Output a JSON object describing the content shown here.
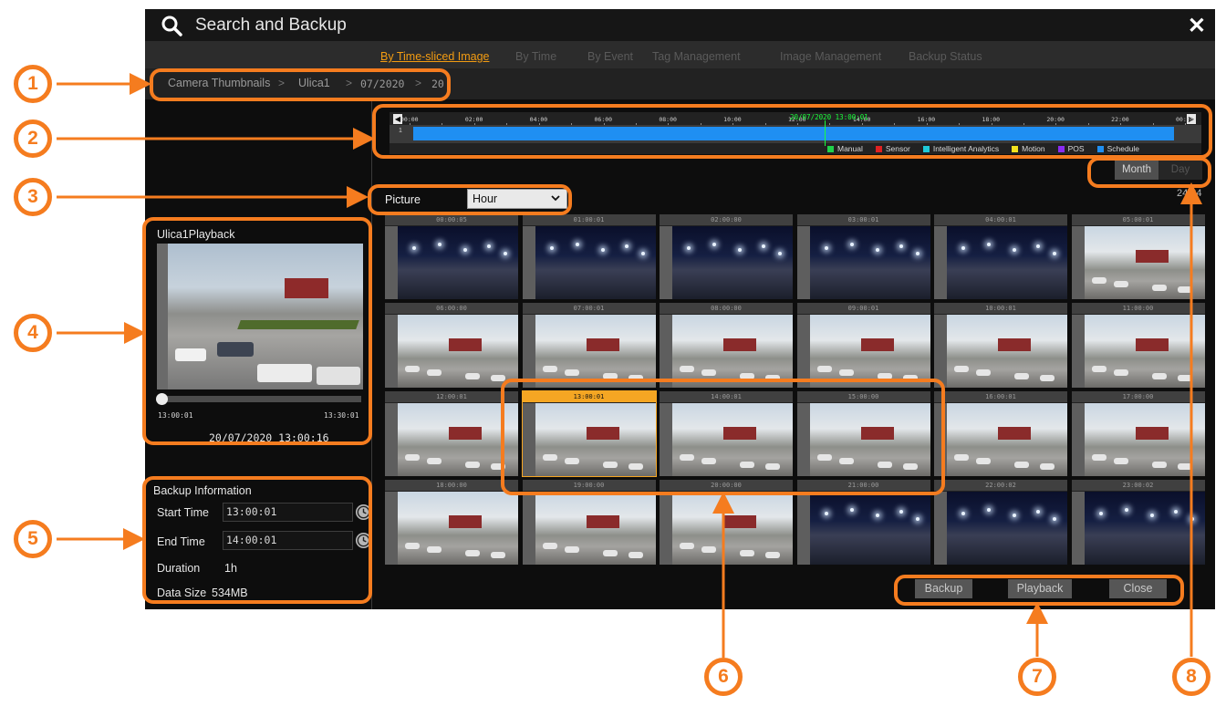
{
  "window": {
    "title": "Search and Backup"
  },
  "tabs": [
    {
      "label": "By Time-sliced Image",
      "active": true
    },
    {
      "label": "By Time"
    },
    {
      "label": "By Event"
    },
    {
      "label": "Tag Management"
    },
    {
      "label": "Image Management"
    },
    {
      "label": "Backup Status"
    }
  ],
  "breadcrumb": [
    "Camera Thumbnails",
    "Ulica1",
    "07/2020",
    "20"
  ],
  "timeline": {
    "channel": "1",
    "current_time": "20/07/2020 13:00:01",
    "hours": [
      "00:00",
      "02:00",
      "04:00",
      "06:00",
      "08:00",
      "10:00",
      "12:00",
      "14:00",
      "16:00",
      "18:00",
      "20:00",
      "22:00",
      "00:00"
    ],
    "legend": [
      {
        "label": "Manual",
        "color": "#1fd14a"
      },
      {
        "label": "Sensor",
        "color": "#e02121"
      },
      {
        "label": "Intelligent Analytics",
        "color": "#1ec9d8"
      },
      {
        "label": "Motion",
        "color": "#f2e21e"
      },
      {
        "label": "POS",
        "color": "#8b2bf2"
      },
      {
        "label": "Schedule",
        "color": "#1f8ff2"
      }
    ],
    "bar_color": "#1f8ff2"
  },
  "view_mode": {
    "month": "Month",
    "day": "Day",
    "selected": "Month"
  },
  "count": "24/24",
  "picture": {
    "label": "Picture",
    "interval": "Hour"
  },
  "thumbnails": [
    {
      "time": "00:00:05",
      "scene": "night"
    },
    {
      "time": "01:00:01",
      "scene": "night"
    },
    {
      "time": "02:00:00",
      "scene": "night"
    },
    {
      "time": "03:00:01",
      "scene": "night"
    },
    {
      "time": "04:00:01",
      "scene": "night"
    },
    {
      "time": "05:00:01",
      "scene": "day"
    },
    {
      "time": "06:00:00",
      "scene": "day"
    },
    {
      "time": "07:00:01",
      "scene": "day"
    },
    {
      "time": "08:00:00",
      "scene": "day"
    },
    {
      "time": "09:00:01",
      "scene": "day"
    },
    {
      "time": "10:00:01",
      "scene": "day"
    },
    {
      "time": "11:00:00",
      "scene": "day"
    },
    {
      "time": "12:00:01",
      "scene": "day"
    },
    {
      "time": "13:00:01",
      "scene": "day",
      "selected": true
    },
    {
      "time": "14:00:01",
      "scene": "day"
    },
    {
      "time": "15:00:00",
      "scene": "day"
    },
    {
      "time": "16:00:01",
      "scene": "day"
    },
    {
      "time": "17:00:00",
      "scene": "day"
    },
    {
      "time": "18:00:00",
      "scene": "day"
    },
    {
      "time": "19:00:00",
      "scene": "day"
    },
    {
      "time": "20:00:00",
      "scene": "day"
    },
    {
      "time": "21:00:00",
      "scene": "night"
    },
    {
      "time": "22:00:02",
      "scene": "night"
    },
    {
      "time": "23:00:02",
      "scene": "night"
    }
  ],
  "player": {
    "title": "Ulica1Playback",
    "start": "13:00:01",
    "end": "13:30:01",
    "datetime": "20/07/2020 13:00:16",
    "progress_percent": 2
  },
  "backup_info": {
    "heading": "Backup Information",
    "start_label": "Start Time",
    "start_value": "13:00:01",
    "end_label": "End Time",
    "end_value": "14:00:01",
    "duration_label": "Duration",
    "duration_value": "1h",
    "size_label": "Data Size",
    "size_value": "534MB"
  },
  "actions": {
    "backup": "Backup",
    "playback": "Playback",
    "close": "Close"
  },
  "annotations": [
    "1",
    "2",
    "3",
    "4",
    "5",
    "6",
    "7",
    "8"
  ],
  "colors": {
    "accent": "#f39c12",
    "annotation": "#f57c1f",
    "timeline_cursor": "#19ff3b"
  }
}
